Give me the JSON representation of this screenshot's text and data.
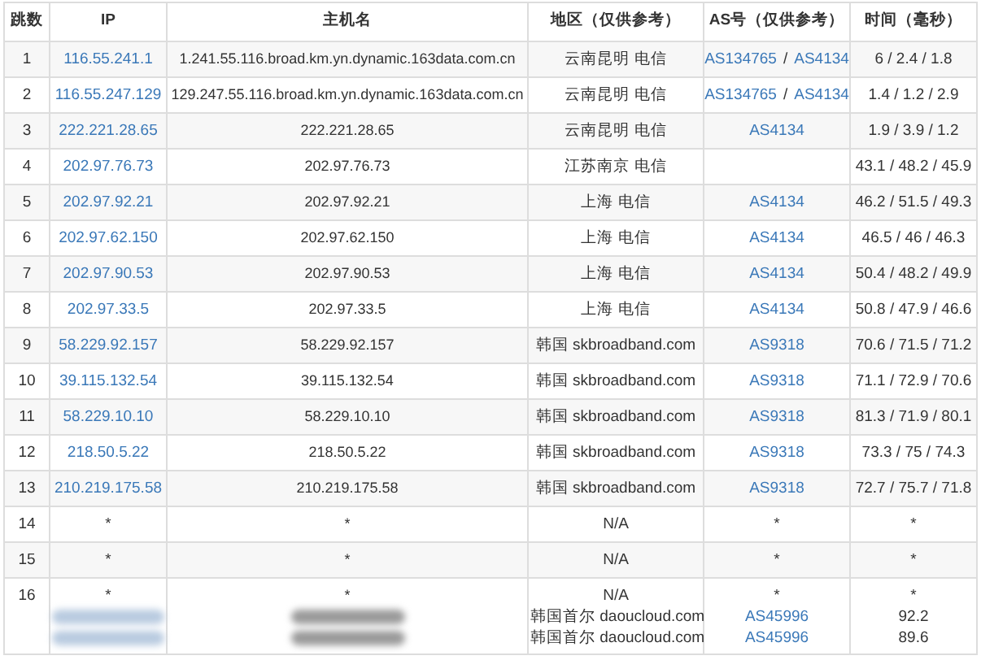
{
  "columns": [
    "跳数",
    "IP",
    "主机名",
    "地区（仅供参考）",
    "AS号（仅供参考）",
    "时间（毫秒）"
  ],
  "rows": [
    {
      "hop": "1",
      "ip": [
        [
          {
            "kind": "link",
            "text": "116.55.241.1"
          }
        ]
      ],
      "host": [
        [
          {
            "kind": "text",
            "text": "1.241.55.116.broad.km.yn.dynamic.163data.com.cn"
          }
        ]
      ],
      "region": [
        "云南昆明 电信"
      ],
      "as": [
        [
          {
            "kind": "link",
            "text": "AS134765"
          },
          {
            "kind": "text",
            "text": "/"
          },
          {
            "kind": "link",
            "text": "AS4134"
          }
        ]
      ],
      "time": [
        "6 / 2.4 / 1.8"
      ]
    },
    {
      "hop": "2",
      "ip": [
        [
          {
            "kind": "link",
            "text": "116.55.247.129"
          }
        ]
      ],
      "host": [
        [
          {
            "kind": "text",
            "text": "129.247.55.116.broad.km.yn.dynamic.163data.com.cn"
          }
        ]
      ],
      "region": [
        "云南昆明 电信"
      ],
      "as": [
        [
          {
            "kind": "link",
            "text": "AS134765"
          },
          {
            "kind": "text",
            "text": "/"
          },
          {
            "kind": "link",
            "text": "AS4134"
          }
        ]
      ],
      "time": [
        "1.4 / 1.2 / 2.9"
      ]
    },
    {
      "hop": "3",
      "ip": [
        [
          {
            "kind": "link",
            "text": "222.221.28.65"
          }
        ]
      ],
      "host": [
        [
          {
            "kind": "text",
            "text": "222.221.28.65"
          }
        ]
      ],
      "region": [
        "云南昆明 电信"
      ],
      "as": [
        [
          {
            "kind": "link",
            "text": "AS4134"
          }
        ]
      ],
      "time": [
        "1.9 / 3.9 / 1.2"
      ]
    },
    {
      "hop": "4",
      "ip": [
        [
          {
            "kind": "link",
            "text": "202.97.76.73"
          }
        ]
      ],
      "host": [
        [
          {
            "kind": "text",
            "text": "202.97.76.73"
          }
        ]
      ],
      "region": [
        "江苏南京 电信"
      ],
      "time": [
        "43.1 / 48.2 / 45.9"
      ]
    },
    {
      "hop": "5",
      "ip": [
        [
          {
            "kind": "link",
            "text": "202.97.92.21"
          }
        ]
      ],
      "host": [
        [
          {
            "kind": "text",
            "text": "202.97.92.21"
          }
        ]
      ],
      "region": [
        "上海 电信"
      ],
      "as": [
        [
          {
            "kind": "link",
            "text": "AS4134"
          }
        ]
      ],
      "time": [
        "46.2 / 51.5 / 49.3"
      ]
    },
    {
      "hop": "6",
      "ip": [
        [
          {
            "kind": "link",
            "text": "202.97.62.150"
          }
        ]
      ],
      "host": [
        [
          {
            "kind": "text",
            "text": "202.97.62.150"
          }
        ]
      ],
      "region": [
        "上海 电信"
      ],
      "as": [
        [
          {
            "kind": "link",
            "text": "AS4134"
          }
        ]
      ],
      "time": [
        "46.5 / 46 / 46.3"
      ]
    },
    {
      "hop": "7",
      "ip": [
        [
          {
            "kind": "link",
            "text": "202.97.90.53"
          }
        ]
      ],
      "host": [
        [
          {
            "kind": "text",
            "text": "202.97.90.53"
          }
        ]
      ],
      "region": [
        "上海 电信"
      ],
      "as": [
        [
          {
            "kind": "link",
            "text": "AS4134"
          }
        ]
      ],
      "time": [
        "50.4 / 48.2 / 49.9"
      ]
    },
    {
      "hop": "8",
      "ip": [
        [
          {
            "kind": "link",
            "text": "202.97.33.5"
          }
        ]
      ],
      "host": [
        [
          {
            "kind": "text",
            "text": "202.97.33.5"
          }
        ]
      ],
      "region": [
        "上海 电信"
      ],
      "as": [
        [
          {
            "kind": "link",
            "text": "AS4134"
          }
        ]
      ],
      "time": [
        "50.8 / 47.9 / 46.6"
      ]
    },
    {
      "hop": "9",
      "ip": [
        [
          {
            "kind": "link",
            "text": "58.229.92.157"
          }
        ]
      ],
      "host": [
        [
          {
            "kind": "text",
            "text": "58.229.92.157"
          }
        ]
      ],
      "region": [
        "韩国 skbroadband.com"
      ],
      "as": [
        [
          {
            "kind": "link",
            "text": "AS9318"
          }
        ]
      ],
      "time": [
        "70.6 / 71.5 / 71.2"
      ]
    },
    {
      "hop": "10",
      "ip": [
        [
          {
            "kind": "link",
            "text": "39.115.132.54"
          }
        ]
      ],
      "host": [
        [
          {
            "kind": "text",
            "text": "39.115.132.54"
          }
        ]
      ],
      "region": [
        "韩国 skbroadband.com"
      ],
      "as": [
        [
          {
            "kind": "link",
            "text": "AS9318"
          }
        ]
      ],
      "time": [
        "71.1 / 72.9 / 70.6"
      ]
    },
    {
      "hop": "11",
      "ip": [
        [
          {
            "kind": "link",
            "text": "58.229.10.10"
          }
        ]
      ],
      "host": [
        [
          {
            "kind": "text",
            "text": "58.229.10.10"
          }
        ]
      ],
      "region": [
        "韩国 skbroadband.com"
      ],
      "as": [
        [
          {
            "kind": "link",
            "text": "AS9318"
          }
        ]
      ],
      "time": [
        "81.3 / 71.9 / 80.1"
      ]
    },
    {
      "hop": "12",
      "ip": [
        [
          {
            "kind": "link",
            "text": "218.50.5.22"
          }
        ]
      ],
      "host": [
        [
          {
            "kind": "text",
            "text": "218.50.5.22"
          }
        ]
      ],
      "region": [
        "韩国 skbroadband.com"
      ],
      "as": [
        [
          {
            "kind": "link",
            "text": "AS9318"
          }
        ]
      ],
      "time": [
        "73.3 / 75 / 74.3"
      ]
    },
    {
      "hop": "13",
      "ip": [
        [
          {
            "kind": "link",
            "text": "210.219.175.58"
          }
        ]
      ],
      "host": [
        [
          {
            "kind": "text",
            "text": "210.219.175.58"
          }
        ]
      ],
      "region": [
        "韩国 skbroadband.com"
      ],
      "as": [
        [
          {
            "kind": "link",
            "text": "AS9318"
          }
        ]
      ],
      "time": [
        "72.7 / 75.7 / 71.8"
      ]
    },
    {
      "hop": "14",
      "ip": [
        [
          {
            "kind": "text",
            "text": "*"
          }
        ]
      ],
      "host": [
        [
          {
            "kind": "text",
            "text": "*"
          }
        ]
      ],
      "region": [
        "N/A"
      ],
      "as": [
        [
          {
            "kind": "text",
            "text": "*"
          }
        ]
      ],
      "time": [
        "*"
      ]
    },
    {
      "hop": "15",
      "ip": [
        [
          {
            "kind": "text",
            "text": "*"
          }
        ]
      ],
      "host": [
        [
          {
            "kind": "text",
            "text": "*"
          }
        ]
      ],
      "region": [
        "N/A"
      ],
      "as": [
        [
          {
            "kind": "text",
            "text": "*"
          }
        ]
      ],
      "time": [
        "*"
      ]
    },
    {
      "hop": "16",
      "ip": [
        [
          {
            "kind": "text",
            "text": "*"
          }
        ],
        [
          {
            "kind": "redacted"
          }
        ],
        [
          {
            "kind": "redacted"
          }
        ]
      ],
      "host": [
        [
          {
            "kind": "text",
            "text": "*"
          }
        ],
        [
          {
            "kind": "redacted"
          }
        ],
        [
          {
            "kind": "redacted"
          }
        ]
      ],
      "region": [
        "N/A",
        "韩国首尔 daoucloud.com",
        "韩国首尔 daoucloud.com"
      ],
      "as": [
        [
          {
            "kind": "text",
            "text": "*"
          }
        ],
        [
          {
            "kind": "link",
            "text": "AS45996"
          }
        ],
        [
          {
            "kind": "link",
            "text": "AS45996"
          }
        ]
      ],
      "time": [
        "*",
        "92.2",
        "89.6"
      ]
    }
  ]
}
